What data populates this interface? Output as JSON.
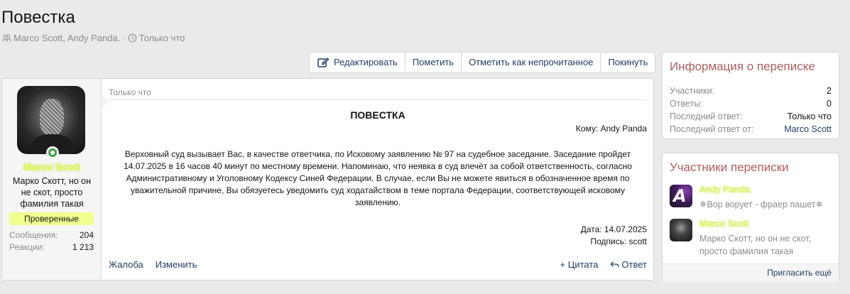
{
  "page": {
    "title": "Повестка",
    "participants": "Marco Scott, Andy Panda.",
    "separator": "·",
    "time": "Только что"
  },
  "toolbar": {
    "edit": "Редактировать",
    "mark": "Пометить",
    "mark_unread": "Отметить как непрочитанное",
    "leave": "Покинуть"
  },
  "author": {
    "name": "Marco Scott",
    "title": "Марко Скотт, но он не скот, просто фамилия такая",
    "banner": "Проверенные",
    "messages_label": "Сообщения:",
    "messages_value": "204",
    "reactions_label": "Реакции:",
    "reactions_value": "1 213"
  },
  "message": {
    "time": "Только что",
    "heading": "ПОВЕСТКА",
    "to": "Кому: Andy Panda",
    "body": "Верховный суд вызывает Вас, в качестве ответчика, по Исковому заявлению № 97 на судебное заседание. Заседание пройдет 14.07.2025 в 16 часов 40 минут по местному времени. Напоминаю, что неявка в суд влечёт за собой ответственность, согласно Административному и Уголовному Кодексу Синей Федерации. В случае, если Вы не можете явиться в обозначенное время по уважительной причине, Вы обязуетесь уведомить суд ходатайством в теме портала Федерации, соответствующей исковому заявлению.",
    "date": "Дата: 14.07.2025",
    "signature": "Подпись: scott",
    "report": "Жалоба",
    "edit": "Изменить",
    "quote": "+ Цитата",
    "reply": "Ответ"
  },
  "info": {
    "title": "Информация о переписке",
    "participants_label": "Участники:",
    "participants_value": "2",
    "replies_label": "Ответы:",
    "replies_value": "0",
    "last_reply_label": "Последний ответ:",
    "last_reply_value": "Только что",
    "last_from_label": "Последний ответ от:",
    "last_from_value": "Marco Scott"
  },
  "members": {
    "title": "Участники переписки",
    "items": [
      {
        "name": "Andy Panda.",
        "subtitle": "✵Вор ворует - фраер пашет✵"
      },
      {
        "name": "Marco Scott",
        "subtitle": "Марко Скотт, но он не скот, просто фамилия такая"
      }
    ],
    "invite": "Пригласить ещё"
  },
  "colors": {
    "link": "#1f3f66",
    "accent_title": "#b35c5c",
    "username_glow": "#dfff4f",
    "banner": "#f1ff8f",
    "online": "#3fa33f"
  }
}
